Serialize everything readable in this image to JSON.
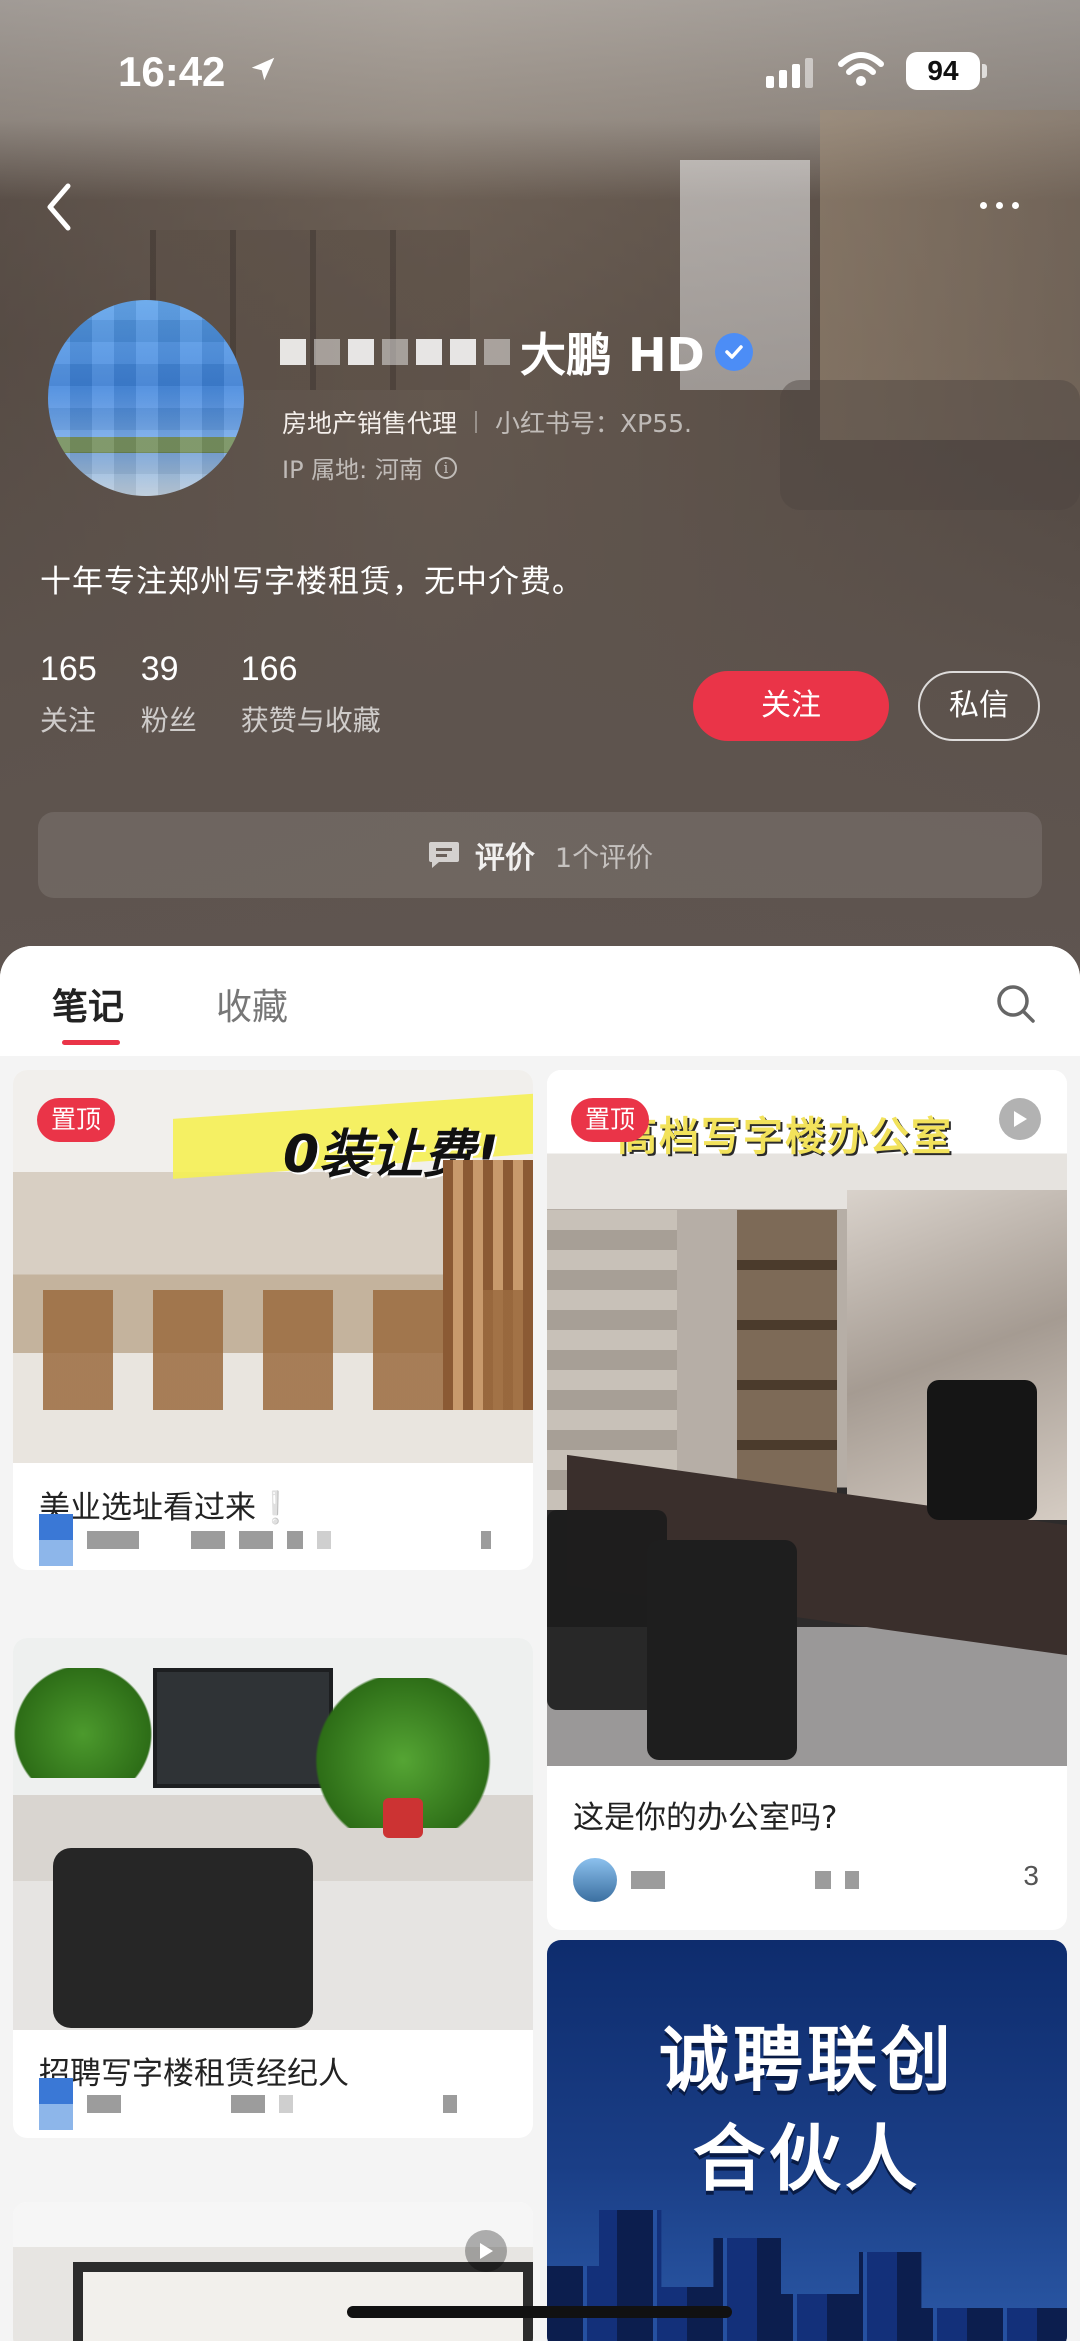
{
  "status_bar": {
    "time": "16:42",
    "battery": "94"
  },
  "profile": {
    "name_visible": "大鹏 HD",
    "occupation": "房地产销售代理",
    "red_id": "小红书号：XP55.",
    "ip_location": "IP 属地: 河南",
    "bio": "十年专注郑州写字楼租赁，无中介费。",
    "stats": [
      {
        "value": "165",
        "label": "关注"
      },
      {
        "value": "39",
        "label": "粉丝"
      },
      {
        "value": "166",
        "label": "获赞与收藏"
      }
    ],
    "follow_label": "关注",
    "message_label": "私信"
  },
  "reviews": {
    "title": "评价",
    "count": "1个评价"
  },
  "tabs": {
    "notes": "笔记",
    "favorites": "收藏"
  },
  "cards": [
    {
      "pin": "置顶",
      "banner": "0装让费!",
      "title": "美业选址看过来❕"
    },
    {
      "pin": "置顶",
      "banner": "高档写字楼办公室",
      "title": "这是你的办公室吗?",
      "likes": "3"
    },
    {
      "title": "招聘写字楼租赁经纪人"
    },
    {
      "line1": "诚聘联创",
      "line2": "合伙人"
    },
    {}
  ],
  "colors": {
    "accent": "#ea3448",
    "verified": "#4c8df6"
  },
  "icons": [
    "location-arrow-icon",
    "signal-icon",
    "wifi-icon",
    "back-icon",
    "more-icon",
    "verified-icon",
    "info-icon",
    "comment-icon",
    "search-icon",
    "play-icon"
  ]
}
